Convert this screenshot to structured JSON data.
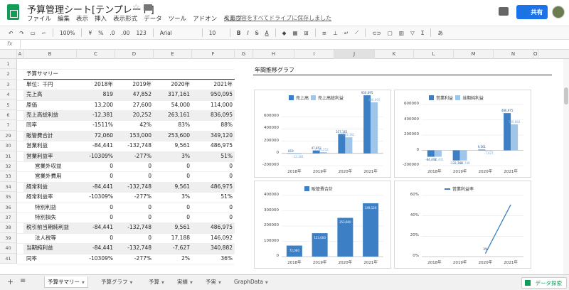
{
  "app": {
    "title": "予算管理シート[テンプレート]",
    "save_link": "変更内容をすべてドライブに保存しました",
    "share_label": "共有",
    "menu": [
      "ファイル",
      "編集",
      "表示",
      "挿入",
      "表示形式",
      "データ",
      "ツール",
      "アドオン",
      "ヘルプ"
    ]
  },
  "toolbar": {
    "zoom": "100%",
    "currency": "¥",
    "percent": "%",
    "decimals_dec": ".0",
    "decimals_inc": ".00",
    "format_more": "123",
    "font": "Arial",
    "font_size": "10",
    "bold": "B",
    "italic": "I",
    "strike": "S",
    "text_color": "A"
  },
  "formula_bar": {
    "fx": "fx",
    "value": ""
  },
  "columns": [
    "A",
    "B",
    "C",
    "D",
    "E",
    "F",
    "G",
    "H",
    "I",
    "J",
    "K",
    "L",
    "M",
    "N",
    "O"
  ],
  "sheet": {
    "section_title": "予算サマリー",
    "unit_label": "単位：千円",
    "year_headers": [
      "2018年",
      "2019年",
      "2020年",
      "2021年"
    ],
    "rows": [
      {
        "num": "1",
        "label": "",
        "values": [
          "",
          "",
          "",
          ""
        ],
        "shaded": false,
        "indent": false
      },
      {
        "num": "2",
        "label": "予算サマリー",
        "values": [
          "",
          "",
          "",
          ""
        ],
        "shaded": false,
        "indent": false,
        "title": true
      },
      {
        "num": "3",
        "label": "単位：千円",
        "values": [
          "2018年",
          "2019年",
          "2020年",
          "2021年"
        ],
        "shaded": false,
        "indent": false
      },
      {
        "num": "4",
        "label": "売上高",
        "values": [
          "819",
          "47,852",
          "317,161",
          "950,095"
        ],
        "shaded": true,
        "indent": false
      },
      {
        "num": "5",
        "label": "原価",
        "values": [
          "13,200",
          "27,600",
          "54,000",
          "114,000"
        ],
        "shaded": false,
        "indent": false
      },
      {
        "num": "6",
        "label": "売上高総利益",
        "values": [
          "-12,381",
          "20,252",
          "263,161",
          "836,095"
        ],
        "shaded": true,
        "indent": false
      },
      {
        "num": "7",
        "label": "同率",
        "values": [
          "-1511%",
          "42%",
          "83%",
          "88%"
        ],
        "shaded": false,
        "indent": false
      },
      {
        "num": "29",
        "label": "販管費合計",
        "values": [
          "72,060",
          "153,000",
          "253,600",
          "349,120"
        ],
        "shaded": true,
        "indent": false
      },
      {
        "num": "30",
        "label": "営業利益",
        "values": [
          "-84,441",
          "-132,748",
          "9,561",
          "486,975"
        ],
        "shaded": false,
        "indent": false
      },
      {
        "num": "31",
        "label": "営業利益率",
        "values": [
          "-10309%",
          "-277%",
          "3%",
          "51%"
        ],
        "shaded": true,
        "indent": false
      },
      {
        "num": "32",
        "label": "営業外収益",
        "values": [
          "0",
          "0",
          "0",
          "0"
        ],
        "shaded": false,
        "indent": true
      },
      {
        "num": "33",
        "label": "営業外費用",
        "values": [
          "0",
          "0",
          "0",
          "0"
        ],
        "shaded": false,
        "indent": true
      },
      {
        "num": "34",
        "label": "経常利益",
        "values": [
          "-84,441",
          "-132,748",
          "9,561",
          "486,975"
        ],
        "shaded": true,
        "indent": false
      },
      {
        "num": "35",
        "label": "経常利益率",
        "values": [
          "-10309%",
          "-277%",
          "3%",
          "51%"
        ],
        "shaded": false,
        "indent": false
      },
      {
        "num": "36",
        "label": "特別利益",
        "values": [
          "0",
          "0",
          "0",
          "0"
        ],
        "shaded": false,
        "indent": true
      },
      {
        "num": "37",
        "label": "特別損失",
        "values": [
          "0",
          "0",
          "0",
          "0"
        ],
        "shaded": false,
        "indent": true
      },
      {
        "num": "38",
        "label": "税引前当期純利益",
        "values": [
          "-84,441",
          "-132,748",
          "9,561",
          "486,975"
        ],
        "shaded": true,
        "indent": false
      },
      {
        "num": "39",
        "label": "法人税等",
        "values": [
          "0",
          "0",
          "17,188",
          "146,092"
        ],
        "shaded": false,
        "indent": true
      },
      {
        "num": "40",
        "label": "当期純利益",
        "values": [
          "-84,441",
          "-132,748",
          "-7,627",
          "340,882"
        ],
        "shaded": true,
        "indent": false
      },
      {
        "num": "41",
        "label": "同率",
        "values": [
          "-10309%",
          "-277%",
          "2%",
          "36%"
        ],
        "shaded": false,
        "indent": false
      }
    ]
  },
  "graph_title": "年間推移グラフ",
  "chart_data": [
    {
      "type": "bar",
      "categories": [
        "2018年",
        "2019年",
        "2020年",
        "2021年"
      ],
      "series": [
        {
          "name": "売上高",
          "values": [
            819,
            47852,
            317161,
            950095
          ],
          "color": "#3d7fc4"
        },
        {
          "name": "売上高総利益",
          "values": [
            -12381,
            20252,
            263161,
            836095
          ],
          "color": "#9fc5e8"
        }
      ],
      "ylim": [
        -200000,
        800000
      ],
      "yticks": [
        -200000,
        0,
        200000,
        400000,
        600000
      ],
      "legend": "top"
    },
    {
      "type": "bar",
      "categories": [
        "2018年",
        "2019年",
        "2020年",
        "2021年"
      ],
      "series": [
        {
          "name": "営業利益",
          "values": [
            -84441,
            -132748,
            9561,
            486975
          ],
          "color": "#3d7fc4"
        },
        {
          "name": "当期純利益",
          "values": [
            -84441,
            -132748,
            -7627,
            340882
          ],
          "color": "#9fc5e8"
        }
      ],
      "ylim": [
        -200000,
        600000
      ],
      "yticks": [
        -200000,
        0,
        200000,
        400000,
        600000
      ],
      "legend": "top"
    },
    {
      "type": "bar",
      "categories": [
        "2018年",
        "2019年",
        "2020年",
        "2021年"
      ],
      "series": [
        {
          "name": "販管費合計",
          "values": [
            72060,
            153000,
            253600,
            349120
          ],
          "color": "#3d7fc4"
        }
      ],
      "ylim": [
        0,
        400000
      ],
      "yticks": [
        0,
        100000,
        200000,
        300000,
        400000
      ],
      "legend": "top"
    },
    {
      "type": "line",
      "categories": [
        "2018年",
        "2019年",
        "2020年",
        "2021年"
      ],
      "series": [
        {
          "name": "営業利益率",
          "values": [
            null,
            null,
            3,
            51
          ],
          "color": "#3d7fc4"
        }
      ],
      "ylim": [
        0,
        60
      ],
      "yticks": [
        "0%",
        "20%",
        "40%",
        "60%"
      ],
      "point_labels": [
        "",
        "",
        "3%",
        ""
      ],
      "legend": "top"
    }
  ],
  "tabs": [
    "予算サマリー",
    "予算グラフ",
    "予算",
    "実績",
    "予実",
    "GraphData"
  ],
  "explore_label": "データ探索"
}
